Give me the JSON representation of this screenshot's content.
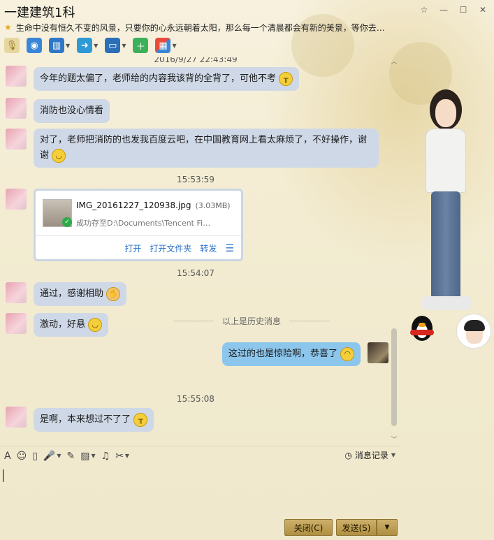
{
  "window": {
    "title": "一建建筑1科",
    "signature": "生命中没有恒久不变的风景，只要你的心永远朝着太阳，那么每一个清晨都会有新的美景，等你去…",
    "controls": [
      "☆",
      "—",
      "☐",
      "✕"
    ]
  },
  "toolbar": {
    "items": [
      {
        "name": "voice-call",
        "icon": "microphone-icon"
      },
      {
        "name": "video-call",
        "icon": "camera-icon"
      },
      {
        "name": "share-screen",
        "icon": "screen-share-icon"
      },
      {
        "name": "send-file",
        "icon": "file-transfer-icon"
      },
      {
        "name": "remote-assist",
        "icon": "remote-desktop-icon"
      },
      {
        "name": "new-chat",
        "icon": "add-chat-icon"
      },
      {
        "name": "apps",
        "icon": "apps-grid-icon"
      }
    ]
  },
  "chat": {
    "partial_timestamp": "2016/9/27 22:43:49",
    "messages": [
      {
        "text": "今年的题太偏了，老师给的内容我该背的全背了，可他不考"
      },
      {
        "text": "消防也没心情看"
      },
      {
        "text": "对了，老师把消防的也发我百度云吧，在中国教育网上看太麻烦了，不好操作，谢谢"
      },
      {
        "text": "通过，感谢相助"
      },
      {
        "text": "激动，好悬"
      },
      {
        "text": "这过的也是惊险啊，恭喜了"
      },
      {
        "text": "是啊，本来想过不了了"
      }
    ],
    "timestamps": [
      "15:53:59",
      "15:54:07",
      "15:55:08"
    ],
    "file": {
      "name": "IMG_20161227_120938.jpg",
      "size": "(3.03MB)",
      "status": "成功存至D:\\Documents\\Tencent Fi…",
      "actions": [
        "打开",
        "打开文件夹",
        "转发"
      ]
    },
    "history_divider": "以上是历史消息"
  },
  "input": {
    "tools": [
      "font-icon",
      "emoji-icon",
      "shake-icon",
      "voice-msg-icon",
      "edit-icon",
      "image-icon",
      "music-icon",
      "screenshot-icon"
    ],
    "history_label": "消息记录"
  },
  "buttons": {
    "close": "关闭(C)",
    "send": "发送(S)"
  },
  "colors": {
    "bubble_other": "#cfd8e6",
    "bubble_self": "#8cc6ec",
    "button": "#c0a155",
    "link": "#2a6fc4"
  }
}
